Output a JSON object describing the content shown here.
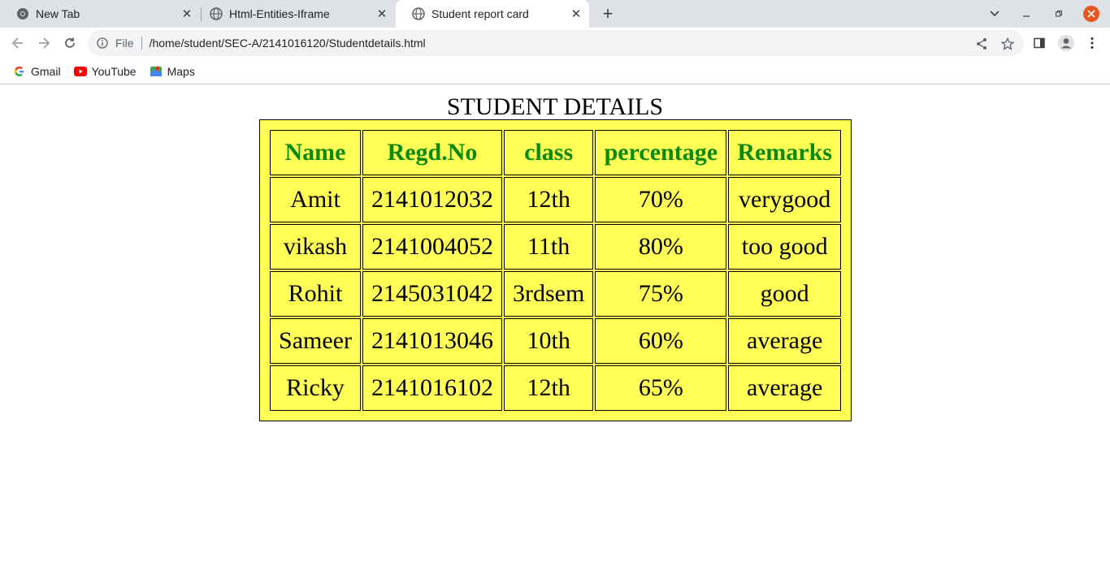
{
  "browser": {
    "tabs": [
      {
        "title": "New Tab",
        "icon": "chrome-icon"
      },
      {
        "title": "Html-Entities-Iframe",
        "icon": "globe-icon"
      },
      {
        "title": "Student report card",
        "icon": "globe-icon",
        "active": true
      }
    ],
    "address": {
      "scheme_label": "File",
      "url": "/home/student/SEC-A/2141016120/Studentdetails.html"
    },
    "bookmarks": [
      {
        "label": "Gmail",
        "icon": "google-icon"
      },
      {
        "label": "YouTube",
        "icon": "youtube-icon"
      },
      {
        "label": "Maps",
        "icon": "maps-icon"
      }
    ],
    "colors": {
      "tabstrip": "#dee1e6",
      "close_button": "#e95420"
    }
  },
  "page": {
    "title": "STUDENT DETAILS",
    "table_colors": {
      "background": "#ffff55",
      "header_text": "#0a8a0a"
    },
    "table": {
      "headers": [
        "Name",
        "Regd.No",
        "class",
        "percentage",
        "Remarks"
      ],
      "rows": [
        [
          "Amit",
          "2141012032",
          "12th",
          "70%",
          "verygood"
        ],
        [
          "vikash",
          "2141004052",
          "11th",
          "80%",
          "too good"
        ],
        [
          "Rohit",
          "2145031042",
          "3rdsem",
          "75%",
          "good"
        ],
        [
          "Sameer",
          "2141013046",
          "10th",
          "60%",
          "average"
        ],
        [
          "Ricky",
          "2141016102",
          "12th",
          "65%",
          "average"
        ]
      ]
    }
  }
}
